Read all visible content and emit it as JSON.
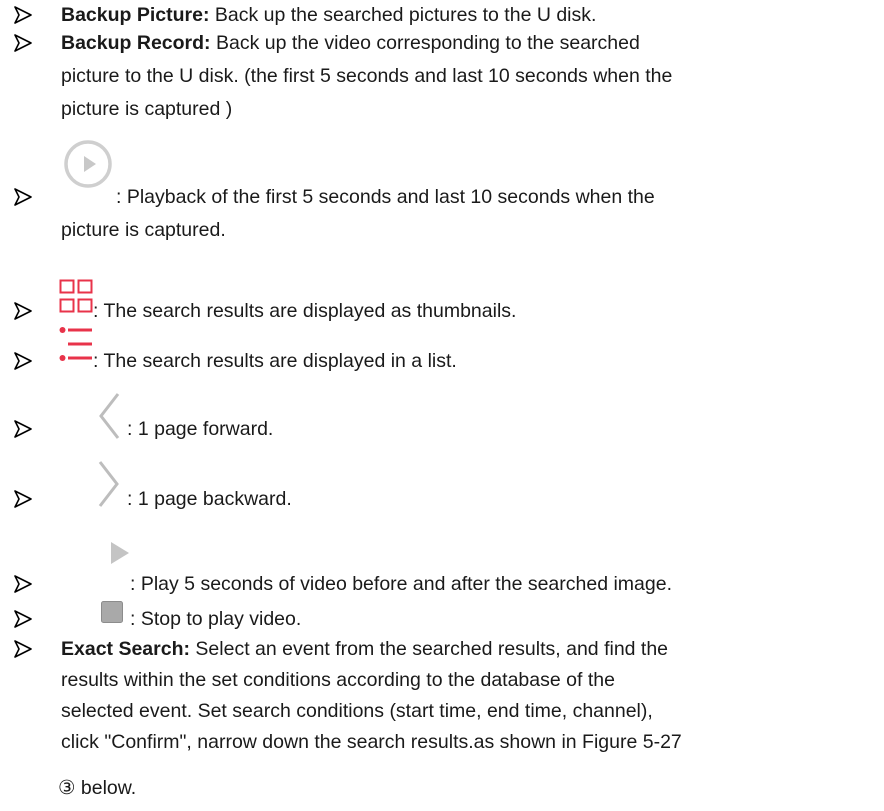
{
  "items": [
    {
      "label": "Backup Picture:",
      "lines": [
        "Back up the searched pictures to the U disk."
      ]
    },
    {
      "label": "Backup Record:",
      "lines": [
        "Back up the video corresponding to the searched",
        "picture to the U disk. (the first 5 seconds and last 10 seconds when the",
        "picture is captured )"
      ]
    },
    {
      "icon": "playback-circle-icon",
      "lines": [
        ": Playback of the first 5 seconds and last 10 seconds when the",
        "picture is captured."
      ]
    },
    {
      "icon": "thumbnail-grid-icon",
      "lines": [
        ": The search results are displayed as thumbnails."
      ]
    },
    {
      "icon": "list-view-icon",
      "lines": [
        ": The search results are displayed in a list."
      ]
    },
    {
      "icon": "chevron-left-icon",
      "lines": [
        ": 1 page forward."
      ]
    },
    {
      "icon": "chevron-right-icon",
      "lines": [
        ": 1 page backward."
      ]
    },
    {
      "icon": "play-triangle-icon",
      "lines": [
        ": Play 5 seconds of video before and after the searched image."
      ]
    },
    {
      "icon": "stop-square-icon",
      "lines": [
        ": Stop to play video."
      ]
    },
    {
      "label": "Exact Search:",
      "lines": [
        "Select an event from the searched results, and find the",
        "results within the set conditions according to the database of the",
        "selected event. Set search conditions (start time, end time, channel),",
        "click \"Confirm\", narrow down the search results.as shown in Figure 5-27",
        "③  below."
      ]
    }
  ],
  "colors": {
    "icon_red": "#e8334a",
    "icon_gray": "#b5b5b5",
    "stop_gray": "#a9a9a9"
  }
}
